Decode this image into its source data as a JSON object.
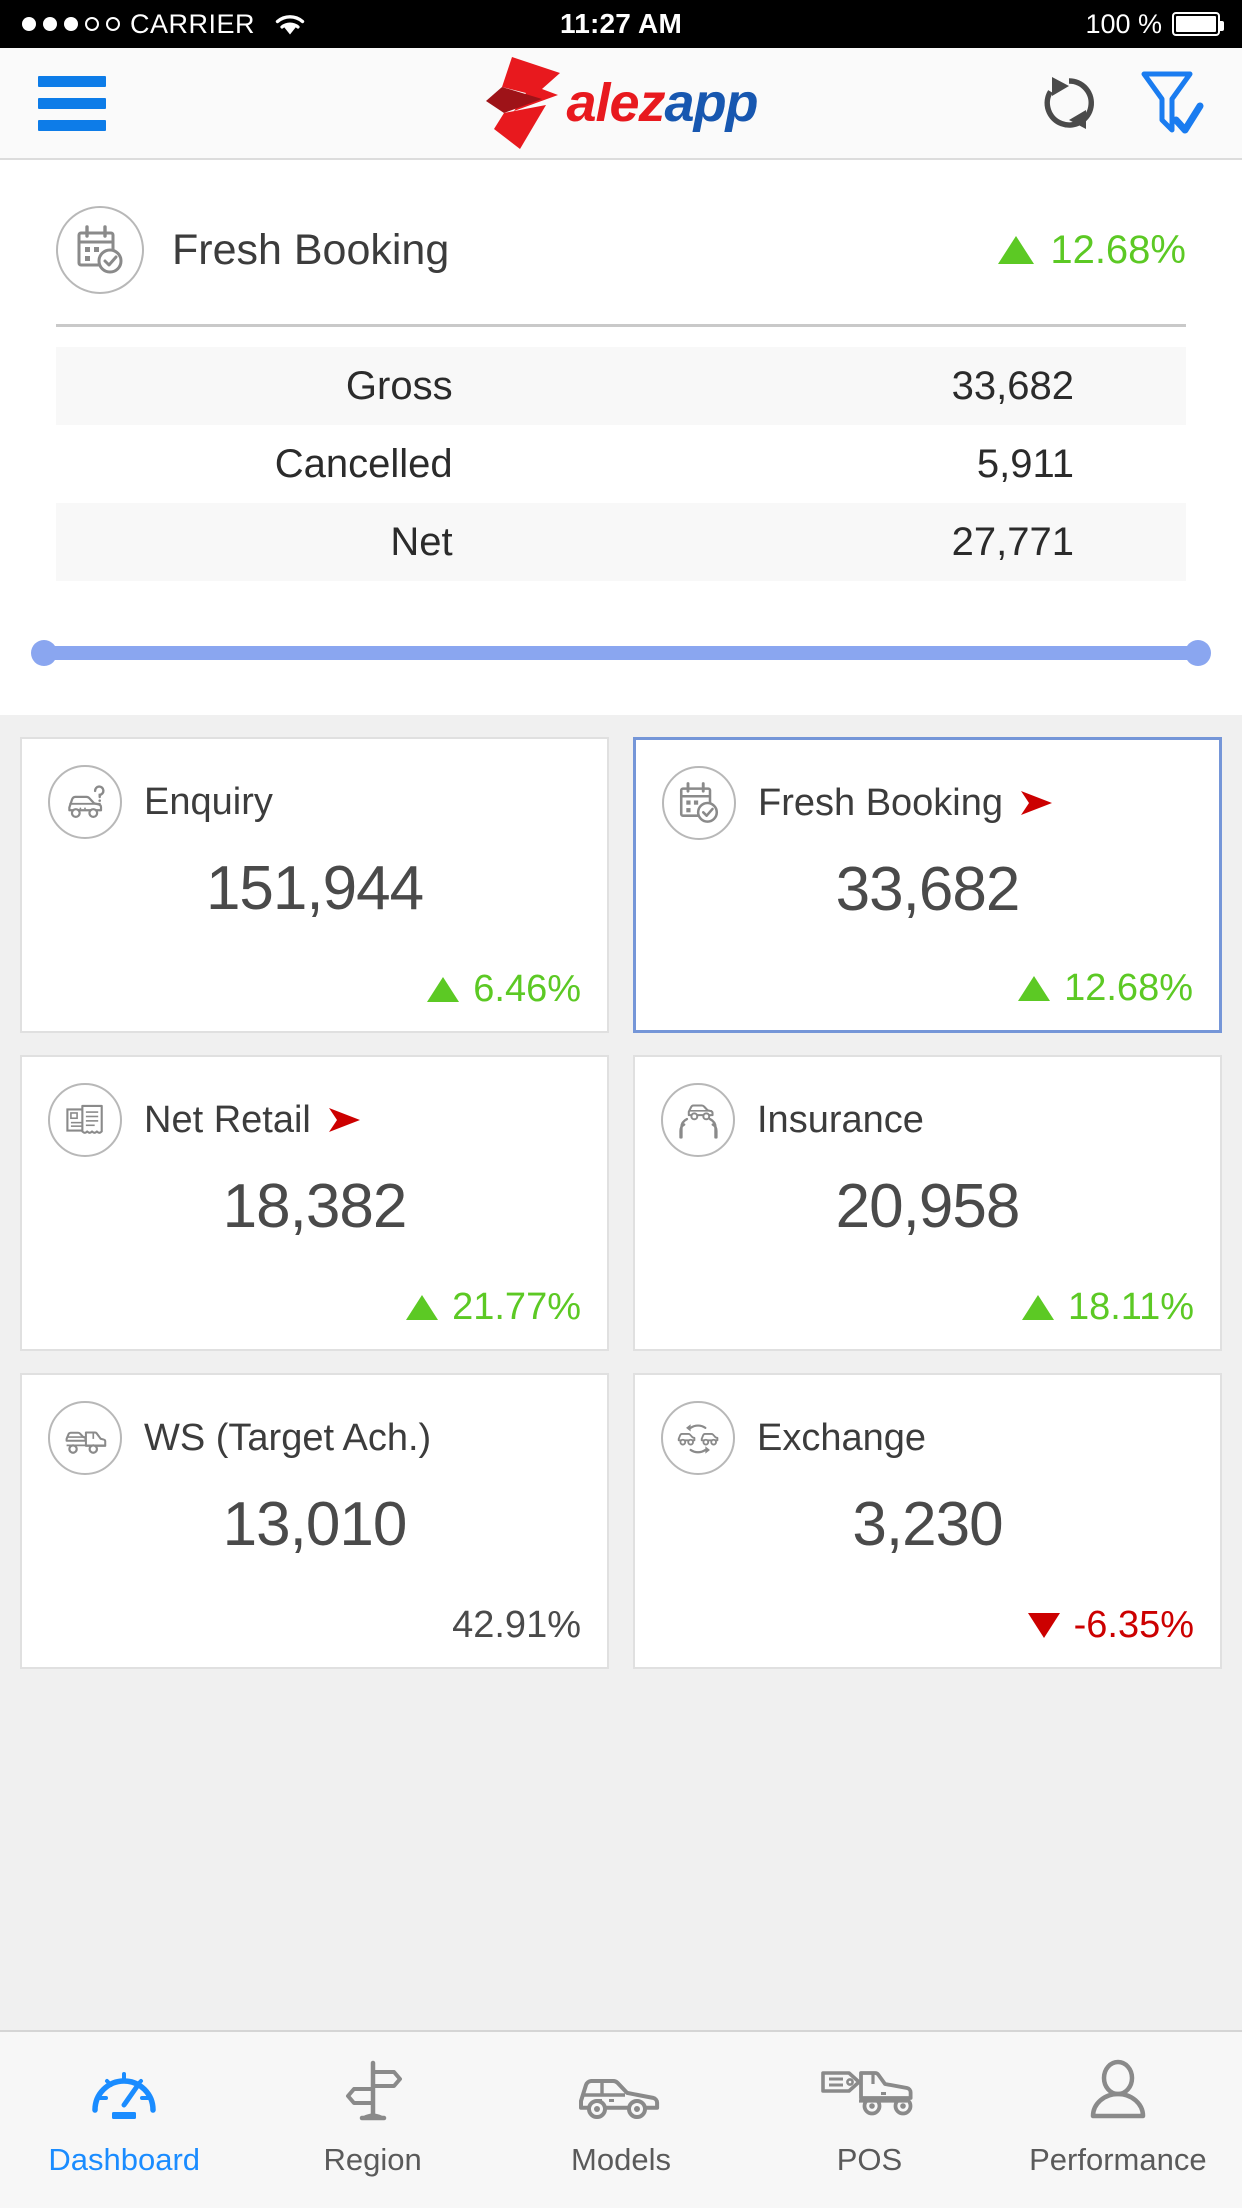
{
  "status_bar": {
    "carrier": "CARRIER",
    "time": "11:27 AM",
    "battery": "100 %",
    "signal_dots_filled": 3,
    "signal_dots_total": 5,
    "wifi_icon": "wifi-icon",
    "battery_icon": "battery-full-icon"
  },
  "app_bar": {
    "menu_icon": "hamburger-menu-icon",
    "logo_red": "alez",
    "logo_blue": "app",
    "logo_mark": "salezapp-arrow-logo",
    "refresh_icon": "refresh-icon",
    "filter_icon": "filter-check-icon"
  },
  "summary": {
    "icon": "calendar-check-icon",
    "title": "Fresh Booking",
    "delta": "12.68%",
    "delta_direction": "up",
    "rows": [
      {
        "label": "Gross",
        "value": "33,682"
      },
      {
        "label": "Cancelled",
        "value": "5,911"
      },
      {
        "label": "Net",
        "value": "27,771"
      }
    ]
  },
  "slider": {
    "name": "date-range-slider",
    "left_handle": "slider-handle-left",
    "right_handle": "slider-handle-right"
  },
  "cards": [
    {
      "id": "enquiry",
      "icon": "car-question-icon",
      "title": "Enquiry",
      "value": "151,944",
      "delta": "6.46%",
      "delta_direction": "up",
      "has_red_arrow": false,
      "selected": false
    },
    {
      "id": "fresh-booking",
      "icon": "calendar-check-icon",
      "title": "Fresh Booking",
      "value": "33,682",
      "delta": "12.68%",
      "delta_direction": "up",
      "has_red_arrow": true,
      "selected": true
    },
    {
      "id": "net-retail",
      "icon": "invoice-receipt-icon",
      "title": "Net Retail",
      "value": "18,382",
      "delta": "21.77%",
      "delta_direction": "up",
      "has_red_arrow": true,
      "selected": false
    },
    {
      "id": "insurance",
      "icon": "car-in-hands-icon",
      "title": "Insurance",
      "value": "20,958",
      "delta": "18.11%",
      "delta_direction": "up",
      "has_red_arrow": false,
      "selected": false
    },
    {
      "id": "ws-target-ach",
      "icon": "car-carrier-truck-icon",
      "title": "WS (Target Ach.)",
      "value": "13,010",
      "delta": "42.91%",
      "delta_direction": "none",
      "has_red_arrow": false,
      "selected": false
    },
    {
      "id": "exchange",
      "icon": "car-exchange-icon",
      "title": "Exchange",
      "value": "3,230",
      "delta": "-6.35%",
      "delta_direction": "down",
      "has_red_arrow": false,
      "selected": false
    }
  ],
  "tabs": [
    {
      "id": "dashboard",
      "label": "Dashboard",
      "icon": "speedometer-icon",
      "active": true
    },
    {
      "id": "region",
      "label": "Region",
      "icon": "signpost-icon",
      "active": false
    },
    {
      "id": "models",
      "label": "Models",
      "icon": "car-icon",
      "active": false
    },
    {
      "id": "pos",
      "label": "POS",
      "icon": "pickup-tag-icon",
      "active": false
    },
    {
      "id": "performance",
      "label": "Performance",
      "icon": "person-icon",
      "active": false
    }
  ],
  "colors": {
    "accent_blue": "#1a8cff",
    "logo_red": "#e8191e",
    "logo_blue": "#1757b0",
    "positive_green": "#5cc924",
    "negative_red": "#cc0000",
    "selected_border": "#7596d8",
    "slider_blue": "#8aa6f0"
  }
}
